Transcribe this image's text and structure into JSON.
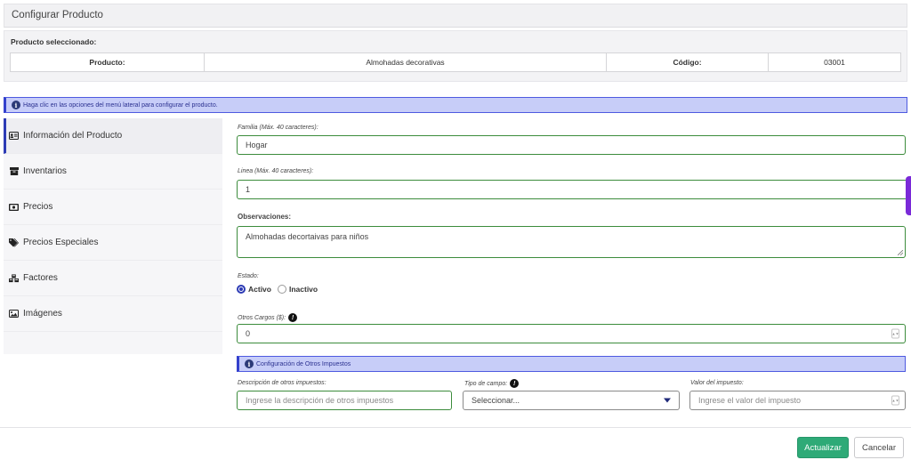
{
  "header": {
    "title": "Configurar Producto"
  },
  "selected_product": {
    "label": "Producto seleccionado:",
    "product_label": "Producto:",
    "product_value": "Almohadas decorativas",
    "code_label": "Código:",
    "code_value": "03001"
  },
  "info_alert": {
    "text": "Haga clic en las opciones del menú lateral para configurar el producto."
  },
  "sidebar": {
    "items": [
      {
        "label": "Información del Producto",
        "icon": "id-card-icon"
      },
      {
        "label": "Inventarios",
        "icon": "box-icon"
      },
      {
        "label": "Precios",
        "icon": "money-bill-icon"
      },
      {
        "label": "Precios Especiales",
        "icon": "tags-icon"
      },
      {
        "label": "Factores",
        "icon": "cubes-icon"
      },
      {
        "label": "Imágenes",
        "icon": "image-icon"
      }
    ]
  },
  "form": {
    "familia": {
      "label": "Familia (Máx. 40 caracteres):",
      "value": "Hogar"
    },
    "linea": {
      "label": "Linea (Máx. 40 caracteres):",
      "value": "1"
    },
    "observaciones": {
      "label": "Observaciones:",
      "value": "Almohadas decortaivas para niños"
    },
    "estado": {
      "label": "Estado:",
      "option_active": "Activo",
      "option_inactive": "Inactivo",
      "selected": "Activo"
    },
    "otros_cargos": {
      "label": "Otros Cargos ($):",
      "value": "0"
    },
    "impuestos": {
      "title": "Configuración de Otros Impuestos",
      "descripcion_label": "Descripción de otros impuestos:",
      "descripcion_placeholder": "Ingrese la descripción de otros impuestos",
      "tipo_label": "Tipo de campo:",
      "tipo_value": "Seleccionar...",
      "valor_label": "Valor del impuesto:",
      "valor_placeholder": "Ingrese el valor del impuesto"
    }
  },
  "footer": {
    "update_label": "Actualizar",
    "cancel_label": "Cancelar"
  },
  "colors": {
    "primary_button": "#2eaa77",
    "accent_blue": "#2d3bb5",
    "alert_bg": "#c7cdf8",
    "input_border": "#3c8c3c"
  }
}
